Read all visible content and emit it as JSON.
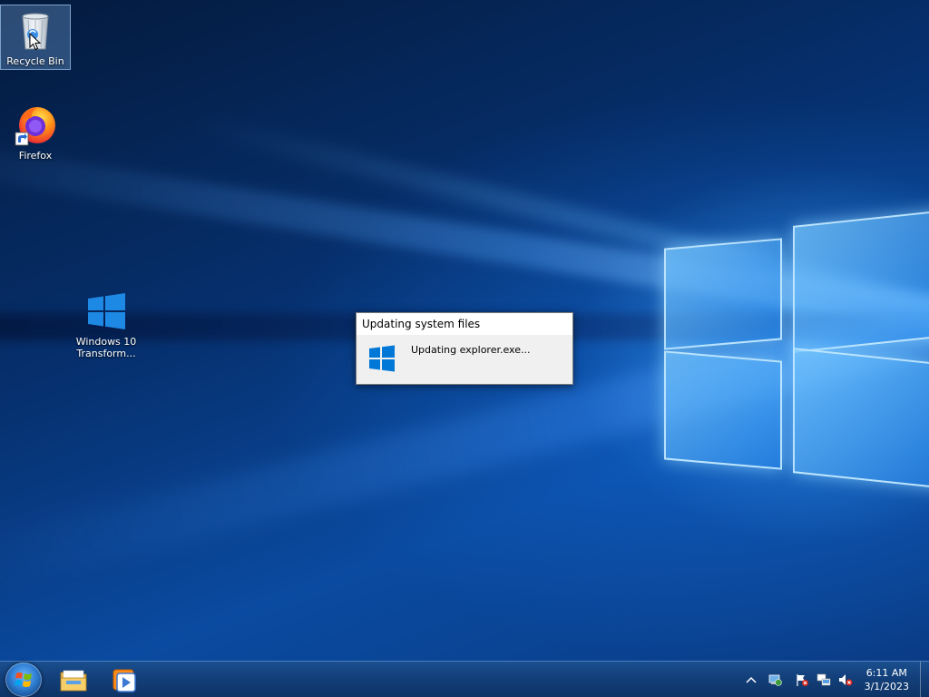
{
  "desktop": {
    "icons": [
      {
        "label": "Recycle Bin",
        "icon": "recycle-bin-icon"
      },
      {
        "label": "Firefox",
        "icon": "firefox-icon"
      },
      {
        "label_line1": "Windows 10",
        "label_line2": "Transform...",
        "icon": "windows-logo-icon"
      }
    ]
  },
  "dialog": {
    "title": "Updating system files",
    "message": "Updating explorer.exe...",
    "icon": "windows-logo-icon"
  },
  "taskbar": {
    "start": {
      "icon": "start-orb-icon"
    },
    "pinned": [
      {
        "icon": "file-explorer-icon"
      },
      {
        "icon": "media-player-icon"
      }
    ],
    "tray": [
      {
        "icon": "chevron-up-icon"
      },
      {
        "icon": "network-update-icon"
      },
      {
        "icon": "action-center-flag-icon"
      },
      {
        "icon": "network-icon"
      },
      {
        "icon": "volume-muted-icon"
      }
    ],
    "clock": {
      "time": "6:11 AM",
      "date": "3/1/2023"
    }
  },
  "colors": {
    "taskbar": "#123e78",
    "desktop_blue": "#0a4aa0",
    "dialog_bg": "#f0f0f0",
    "windows_blue": "#0078d7"
  }
}
